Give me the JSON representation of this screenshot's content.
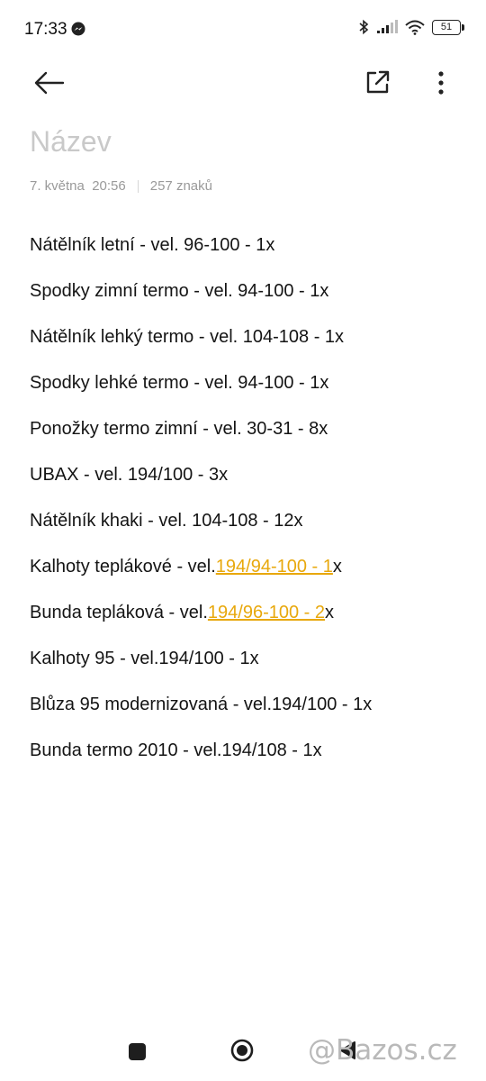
{
  "status_bar": {
    "time": "17:33",
    "battery": "51",
    "icons": [
      "messenger-icon",
      "bluetooth-icon",
      "signal-icon",
      "wifi-icon",
      "battery-icon"
    ]
  },
  "toolbar": {
    "icons": [
      "back-arrow-icon",
      "share-icon",
      "more-vertical-icon"
    ]
  },
  "note": {
    "title": "Název",
    "date": "7. května  20:56",
    "char_count": "257 znaků",
    "lines": [
      "Nátělník letní - vel. 96-100 - 1x",
      "Spodky zimní termo - vel. 94-100 - 1x",
      "Nátělník lehký termo - vel. 104-108 - 1x",
      "Spodky lehké termo - vel. 94-100 - 1x",
      "Ponožky termo zimní - vel. 30-31 - 8x",
      "UBAX - vel. 194/100 - 3x",
      "Nátělník khaki - vel. 104-108 - 12x",
      {
        "before": "Kalhoty teplákové - vel.",
        "link": "194/94-100 - 1",
        "after": "x"
      },
      {
        "before": "Bunda tepláková - vel.",
        "link": "194/96-100 - 2",
        "after": "x"
      },
      "Kalhoty 95 - vel.194/100 - 1x",
      "Blůza 95 modernizovaná - vel.194/100 - 1x",
      "Bunda termo 2010 - vel.194/108 - 1x"
    ]
  },
  "colors": {
    "link": "#e8a80c",
    "title_placeholder": "#c9c9c9",
    "meta": "#9a9a9a"
  },
  "watermark": "@Bazos.cz",
  "nav_icons": [
    "recents-square-icon",
    "home-circle-icon",
    "back-triangle-icon"
  ]
}
